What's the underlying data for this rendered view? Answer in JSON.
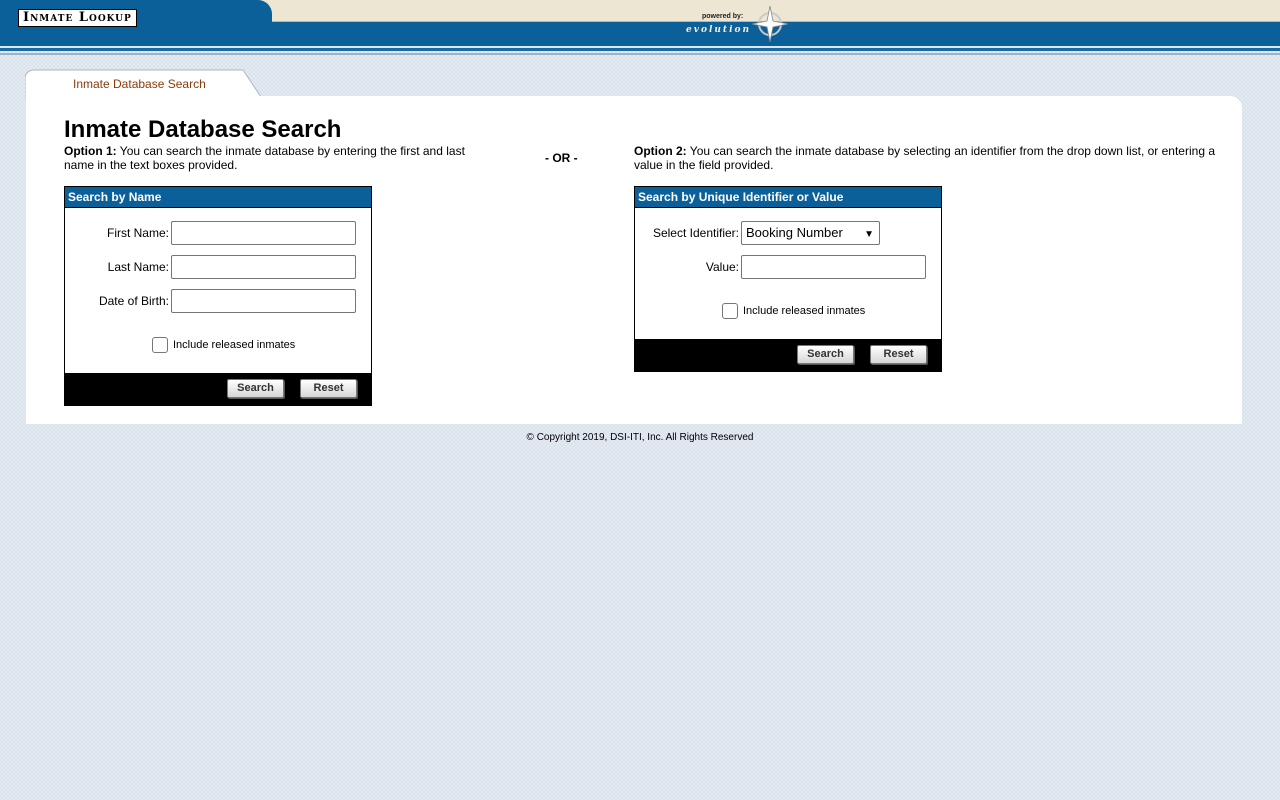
{
  "header": {
    "logo_text": "Inmate Lookup",
    "powered_by": "powered by:",
    "evolution": "evolution"
  },
  "tab": {
    "label": "Inmate Database Search"
  },
  "page": {
    "title": "Inmate Database Search"
  },
  "option1": {
    "label": "Option 1:",
    "text": " You can search the inmate database by entering the first and last name in the text boxes provided."
  },
  "or_label": "- OR -",
  "option2": {
    "label": "Option 2:",
    "text": " You can search the inmate database by selecting an identifier from the drop down list, or entering a value in the field provided."
  },
  "name_search": {
    "heading": "Search by Name",
    "first_name_label": "First Name:",
    "first_name_value": "",
    "last_name_label": "Last Name:",
    "last_name_value": "",
    "dob_label": "Date of Birth:",
    "dob_value": "",
    "include_released_label": "Include released inmates",
    "include_released_checked": false,
    "search_label": "Search",
    "reset_label": "Reset"
  },
  "id_search": {
    "heading": "Search by Unique Identifier or Value",
    "identifier_label": "Select Identifier:",
    "identifier_selected": "Booking Number",
    "value_label": "Value:",
    "value_value": "",
    "include_released_label": "Include released inmates",
    "include_released_checked": false,
    "search_label": "Search",
    "reset_label": "Reset"
  },
  "footer": {
    "copyright": "© Copyright 2019, DSI-ITI, Inc. All Rights Reserved"
  },
  "colors": {
    "header_blue": "#0c6099",
    "tab_text": "#8b3a0a",
    "header_tan": "#ece6d2"
  }
}
